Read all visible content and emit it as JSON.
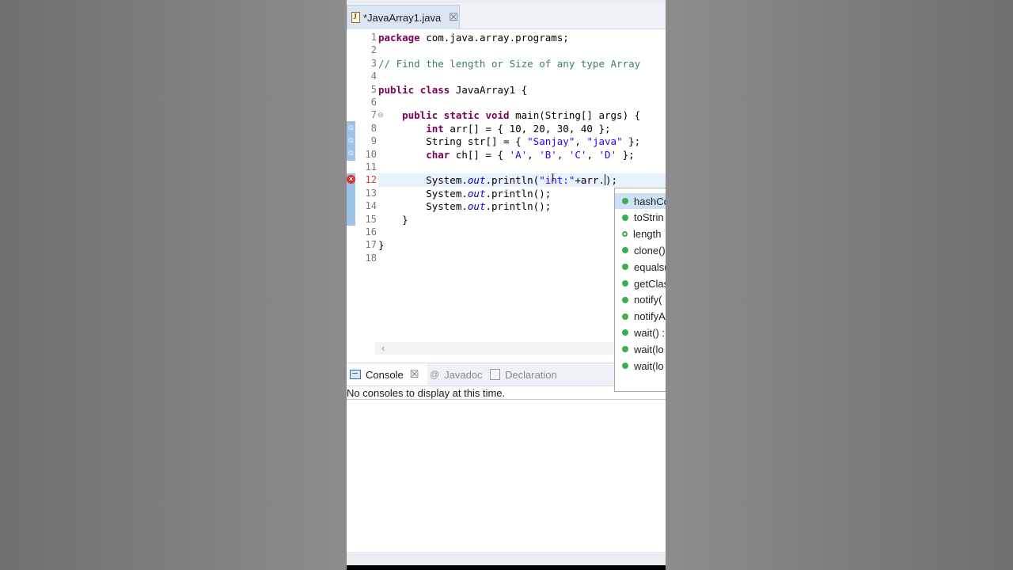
{
  "editor_tab": {
    "title": "*JavaArray1.java",
    "close": "☒"
  },
  "code_lines": [
    {
      "n": "1",
      "text": "package com.java.array.programs;"
    },
    {
      "n": "2",
      "text": ""
    },
    {
      "n": "3",
      "text": "// Find the length or Size of any type Array"
    },
    {
      "n": "4",
      "text": ""
    },
    {
      "n": "5",
      "text": "public class JavaArray1 {"
    },
    {
      "n": "6",
      "text": ""
    },
    {
      "n": "7",
      "text": "    public static void main(String[] args) {"
    },
    {
      "n": "8",
      "text": "        int arr[] = { 10, 20, 30, 40 };"
    },
    {
      "n": "9",
      "text": "        String str[] = { \"Sanjay\", \"java\" };"
    },
    {
      "n": "10",
      "text": "        char ch[] = { 'A', 'B', 'C', 'D' };"
    },
    {
      "n": "11",
      "text": ""
    },
    {
      "n": "12",
      "text": "        System.out.println(\"int:\"+arr.);"
    },
    {
      "n": "13",
      "text": "        System.out.println();"
    },
    {
      "n": "14",
      "text": "        System.out.println();"
    },
    {
      "n": "15",
      "text": "    }"
    },
    {
      "n": "16",
      "text": ""
    },
    {
      "n": "17",
      "text": "}"
    },
    {
      "n": "18",
      "text": ""
    }
  ],
  "autocomplete": {
    "items": [
      "hashCo",
      "toStrin",
      "length",
      "clone()",
      "equals(",
      "getClas",
      "notify(",
      "notifyA",
      "wait() :",
      "wait(lo",
      "wait(lo"
    ],
    "selected_index": 0
  },
  "views": {
    "tabs": [
      "Console",
      "Javadoc",
      "Declaration"
    ],
    "active": "Console",
    "console_message": "No consoles to display at this time."
  },
  "colors": {
    "keyword": "#7f0055",
    "comment": "#3f7f5f",
    "string": "#2a00ff",
    "field": "#0000c0",
    "error": "#d8312f",
    "modified_bar": "#9cc3e5",
    "selection": "#cfe0f5"
  }
}
